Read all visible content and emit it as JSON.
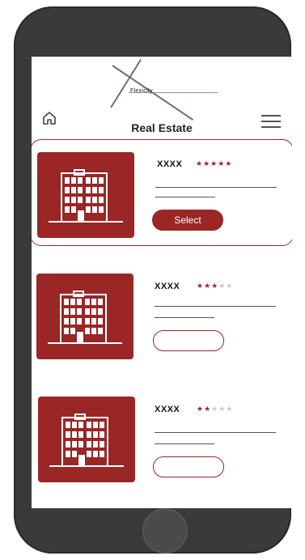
{
  "app": {
    "logo_text": "Flexicity",
    "title": "Real Estate"
  },
  "listings": [
    {
      "name": "XXXX",
      "rating": 5,
      "selected": true,
      "button_label": "Select"
    },
    {
      "name": "XXXX",
      "rating": 3,
      "selected": false,
      "button_label": ""
    },
    {
      "name": "XXXX",
      "rating": 2,
      "selected": false,
      "button_label": ""
    }
  ],
  "colors": {
    "accent": "#9a2626",
    "phone": "#3a3a3a"
  }
}
